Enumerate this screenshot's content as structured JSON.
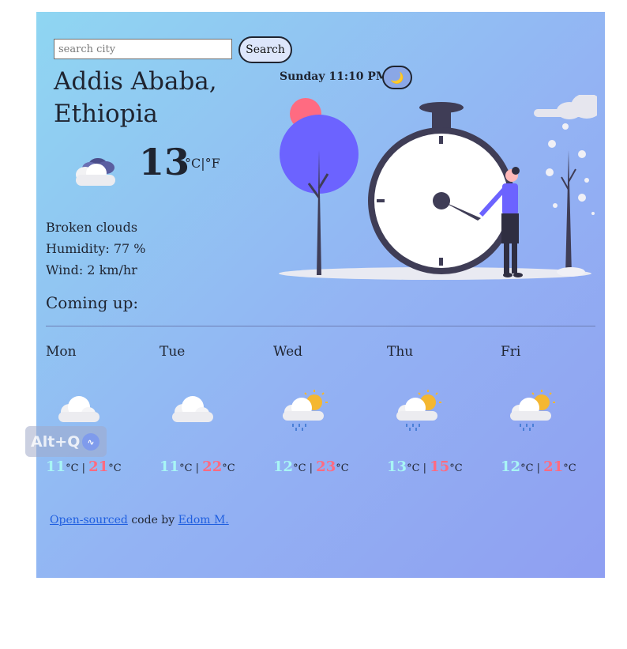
{
  "search": {
    "placeholder": "search city",
    "button_label": "Search"
  },
  "location": {
    "line1": "Addis Ababa,",
    "line2": "Ethiopia"
  },
  "datetime": "Sunday 11:10 PM",
  "theme_toggle": {
    "icon": "moon-icon",
    "glyph": "🌙"
  },
  "current": {
    "temperature": "13",
    "unit_c": "°C",
    "unit_sep": "|",
    "unit_f": "°F",
    "icon": "broken-clouds-night-icon",
    "description": "Broken clouds",
    "humidity": "Humidity: 77 %",
    "wind": "Wind: 2 km/hr"
  },
  "forecast_heading": "Coming up:",
  "forecast": [
    {
      "day": "Mon",
      "min": "11",
      "max": "21",
      "icon": "cloud-icon"
    },
    {
      "day": "Tue",
      "min": "11",
      "max": "22",
      "icon": "cloud-icon"
    },
    {
      "day": "Wed",
      "min": "12",
      "max": "23",
      "icon": "sun-cloud-rain-icon"
    },
    {
      "day": "Thu",
      "min": "13",
      "max": "15",
      "icon": "sun-cloud-rain-icon"
    },
    {
      "day": "Fri",
      "min": "12",
      "max": "21",
      "icon": "sun-cloud-rain-icon"
    }
  ],
  "temp_unit": "°C",
  "temp_sep": " | ",
  "footer": {
    "link1": "Open-sourced",
    "middle": " code by ",
    "link2": "Edom M."
  },
  "overlay": {
    "label": "Alt+Q"
  },
  "colors": {
    "min_temp": "#a8f5f5",
    "max_temp": "#ff6b81",
    "link": "#1f5fe0",
    "accent_purple": "#6c63ff"
  }
}
